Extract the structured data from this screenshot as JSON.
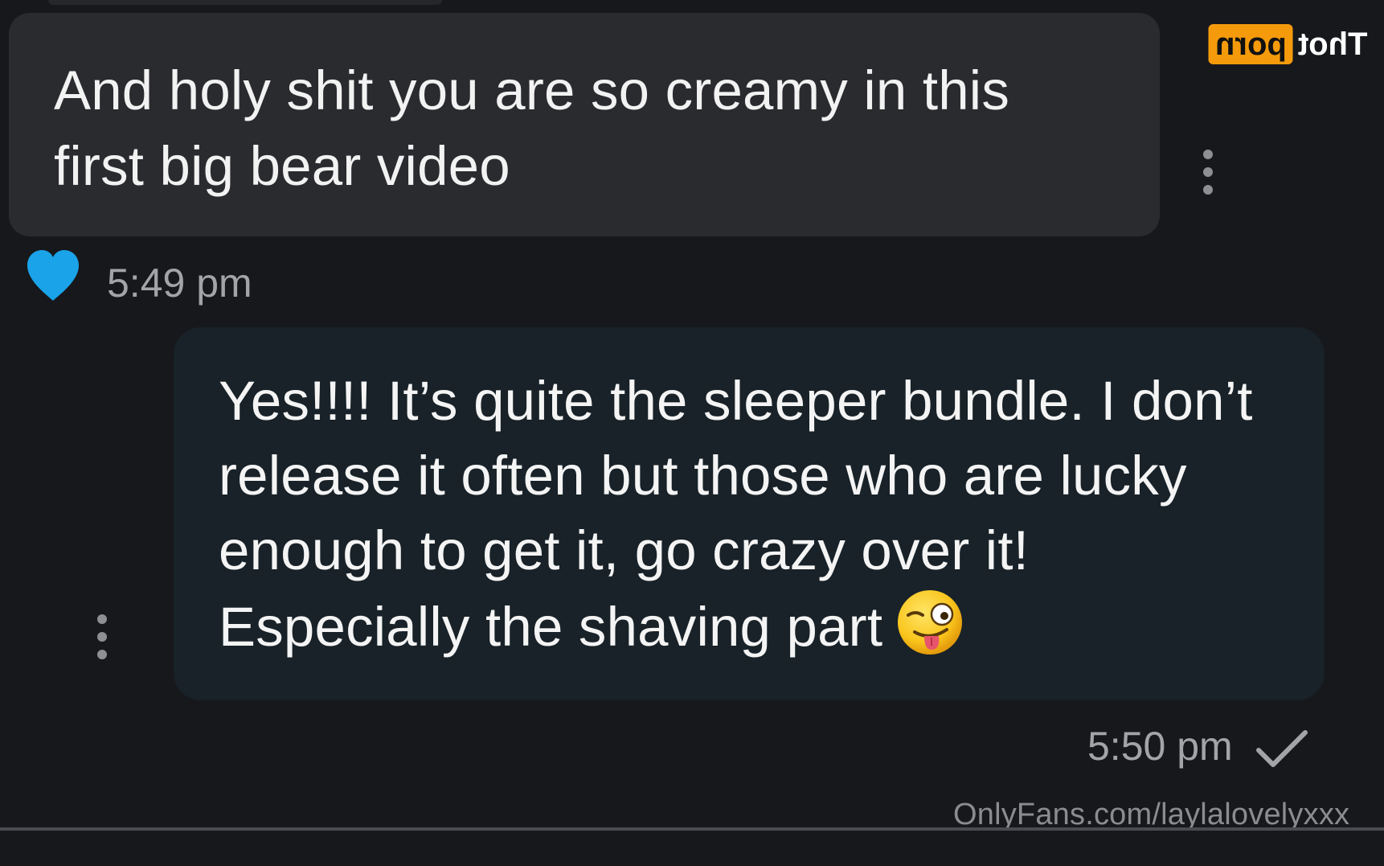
{
  "messages": {
    "incoming": {
      "text": "And holy shit you are so creamy in this first big bear video",
      "time": "5:49 pm",
      "liked": true
    },
    "outgoing": {
      "text": "Yes!!!! It’s quite the sleeper bundle. I don’t release it often but those who are lucky enough to get it, go crazy over it! Especially the shaving part",
      "emoji": "winking-face-with-tongue",
      "time": "5:50 pm",
      "status": "sent-check"
    }
  },
  "watermark": {
    "site": "OnlyFans.com/laylalovelyxxx"
  },
  "logo": {
    "part1": "Thot",
    "part2": "porn",
    "accent_color": "#f59b0b"
  },
  "colors": {
    "background": "#17181c",
    "incoming_bubble": "#2a2b2f",
    "outgoing_bubble": "#182228",
    "heart": "#1aa3e8"
  }
}
